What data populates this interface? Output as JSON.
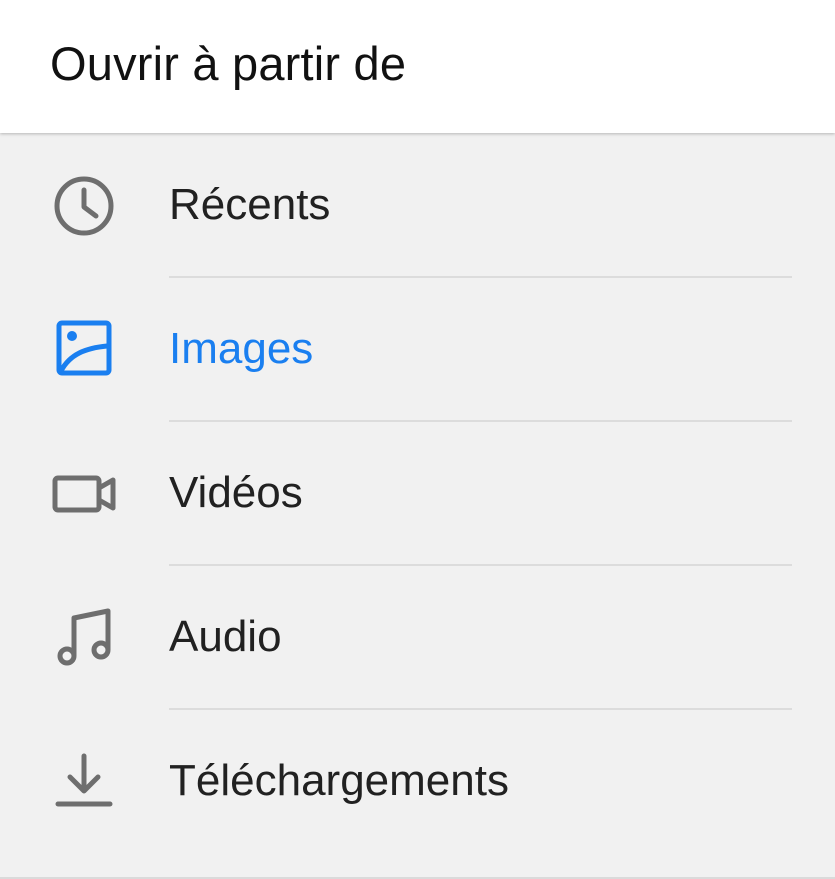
{
  "header": {
    "title": "Ouvrir à partir de"
  },
  "colors": {
    "accent": "#1a7ff0",
    "icon_default": "#6e6e6e",
    "text_default": "#212121"
  },
  "items": [
    {
      "label": "Récents",
      "icon": "clock-icon",
      "active": false
    },
    {
      "label": "Images",
      "icon": "image-icon",
      "active": true
    },
    {
      "label": "Vidéos",
      "icon": "video-camera-icon",
      "active": false
    },
    {
      "label": "Audio",
      "icon": "music-note-icon",
      "active": false
    },
    {
      "label": "Téléchargements",
      "icon": "download-icon",
      "active": false
    }
  ]
}
